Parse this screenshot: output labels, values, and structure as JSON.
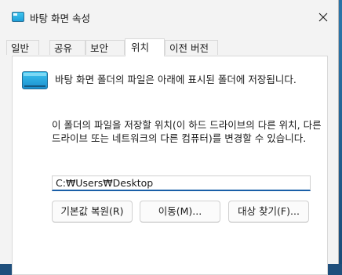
{
  "window": {
    "title": "바탕 화면 속성",
    "close_label": "닫기"
  },
  "tabs": [
    {
      "label": "일반",
      "active": false
    },
    {
      "label": "공유",
      "active": false
    },
    {
      "label": "보안",
      "active": false
    },
    {
      "label": "위치",
      "active": true
    },
    {
      "label": "이전 버전",
      "active": false
    }
  ],
  "location": {
    "description": "바탕 화면 폴더의 파일은 아래에 표시된 폴더에 저장됩니다.",
    "info": "이 폴더의 파일을 저장할 위치(이 하드 드라이브의 다른 위치, 다른 드라이브 또는 네트워크의 다른 컴퓨터)를 변경할 수 있습니다.",
    "path_value": "C:₩Users₩Desktop",
    "restore_default_label": "기본값 복원(R)",
    "move_label": "이동(M)...",
    "find_target_label": "대상 찾기(F)..."
  },
  "icons": {
    "title_icon": "desktop-folder-icon",
    "folder_icon": "desktop-folder-icon",
    "close_icon": "close-icon"
  }
}
